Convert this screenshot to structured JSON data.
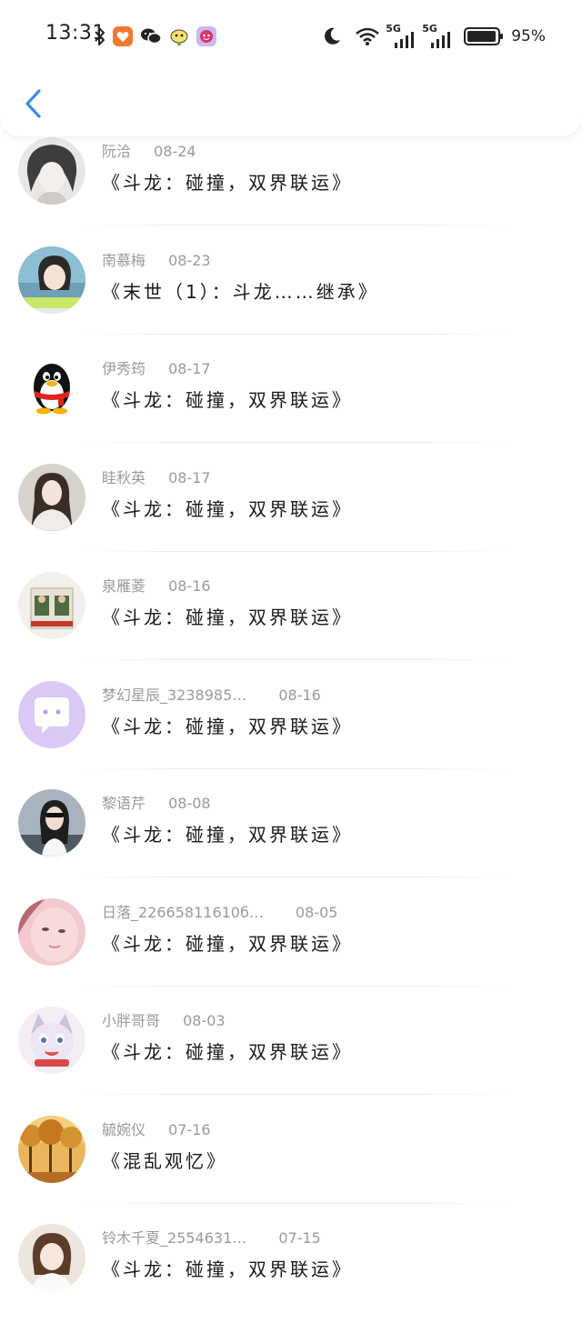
{
  "status_bar": {
    "time": "13:31",
    "network_1": "5G",
    "network_2": "5G",
    "battery": "95%"
  },
  "colors": {
    "accent": "#3a8ee6",
    "meta_text": "#9a9a9a",
    "title_text": "#1a1a1a"
  },
  "icons": {
    "back": "chevron-left-icon",
    "qq_default_avatar": "penguin-icon",
    "chat_avatar": "chat-bubble-icon"
  },
  "items": [
    {
      "name": "阮洽",
      "date": "08-24",
      "title": "《斗龙：碰撞，双界联运》",
      "avatar": "photo-gray-portrait"
    },
    {
      "name": "南慕梅",
      "date": "08-23",
      "title": "《末世（1）：斗龙……继承》",
      "avatar": "photo-girl"
    },
    {
      "name": "伊秀筠",
      "date": "08-17",
      "title": "《斗龙：碰撞，双界联运》",
      "avatar": "penguin"
    },
    {
      "name": "眭秋英",
      "date": "08-17",
      "title": "《斗龙：碰撞，双界联运》",
      "avatar": "photo-girl-white"
    },
    {
      "name": "泉雁菱",
      "date": "08-16",
      "title": "《斗龙：碰撞，双界联运》",
      "avatar": "photo-building"
    },
    {
      "name": "梦幻星辰_3238985…",
      "date": "08-16",
      "title": "《斗龙：碰撞，双界联运》",
      "avatar": "chat-bubble"
    },
    {
      "name": "黎语芹",
      "date": "08-08",
      "title": "《斗龙：碰撞，双界联运》",
      "avatar": "photo-girl-sunglasses"
    },
    {
      "name": "日落_22665811610б…",
      "date": "08-05",
      "title": "《斗龙：碰撞，双界联运》",
      "avatar": "photo-pink-face"
    },
    {
      "name": "小胖哥哥",
      "date": "08-03",
      "title": "《斗龙：碰撞，双界联运》",
      "avatar": "cartoon-cat"
    },
    {
      "name": "毓婉仪",
      "date": "07-16",
      "title": "《混乱观忆》",
      "avatar": "photo-autumn-trees"
    },
    {
      "name": "铃木千夏_2554631…",
      "date": "07-15",
      "title": "《斗龙：碰撞，双界联运》",
      "avatar": "photo-girl-bob"
    }
  ]
}
